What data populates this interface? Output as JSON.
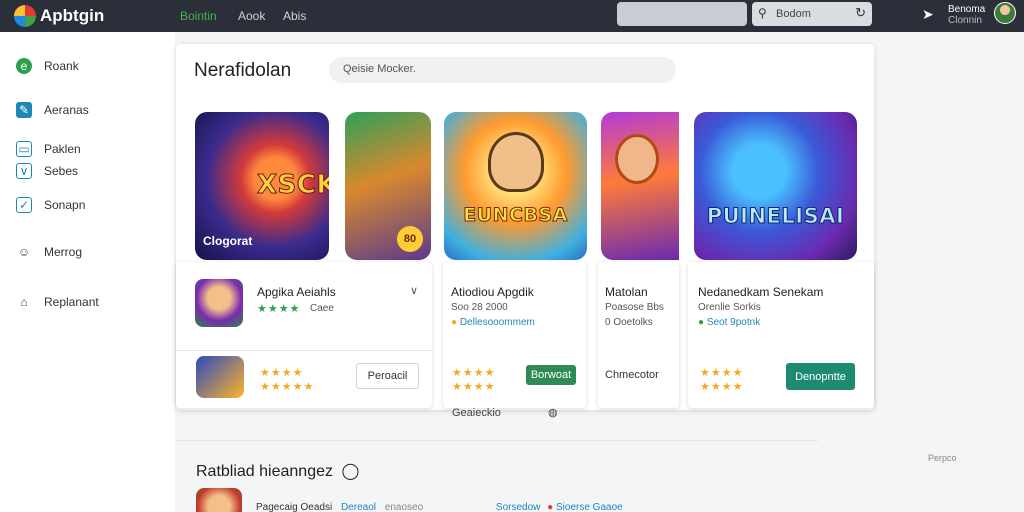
{
  "topbar": {
    "brand": "Apbtgin",
    "nav": [
      {
        "label": "Bointin",
        "active": true
      },
      {
        "label": "Aook",
        "active": false
      },
      {
        "label": "Abis",
        "active": false
      }
    ],
    "search_text": "Bodom",
    "user_line1": "Benoma",
    "user_line2": "Clonnin"
  },
  "sidebar": {
    "items": [
      {
        "label": "Roank",
        "icon": "circle-icon"
      },
      {
        "label": "Aeranas",
        "icon": "square-icon"
      },
      {
        "label": "Paklen",
        "icon": "tray-icon"
      },
      {
        "label": "Sebes",
        "icon": "chevron-down-icon"
      },
      {
        "label": "Sonapn",
        "icon": "check-square-icon"
      },
      {
        "label": "Merrog",
        "icon": "smile-icon"
      },
      {
        "label": "Replanant",
        "icon": "home-icon"
      }
    ]
  },
  "main": {
    "title": "Nerafidolan",
    "search_placeholder": "Qeisie Mocker."
  },
  "tiles": [
    {
      "title": "XSCKN",
      "tag": "Clogorat",
      "badge": "80"
    },
    {
      "title": "EUNCBSA",
      "tag": ""
    },
    {
      "title": "",
      "tag": ""
    },
    {
      "title": "PUINELISAI",
      "tag": ""
    }
  ],
  "cards": [
    {
      "name": "Apgika Aeiahls",
      "sub": "Caee",
      "button": "Peroacil"
    },
    {
      "name": "Atiodiou Apgdik",
      "sub1": "Soo 28 2000",
      "sub2": "Dellesooommem",
      "button": "Borwoat"
    },
    {
      "name": "Matolan",
      "sub1": "Poasose Bbs",
      "sub2": "0 Ooetolks",
      "button": "Chmecotor"
    },
    {
      "name": "Nedanedkam Senekam",
      "sub1": "Orenlie Sorkis",
      "sub2": "Seot 9potnk",
      "button": "Denopntte"
    }
  ],
  "below_cards_text": "Geaieckio",
  "right_small": "Perpco",
  "section_title": "Ratbliad hieanngez",
  "footer_text": "Pagecaig Oeadsi",
  "footer_links": [
    "Dereaol",
    "enaoseo"
  ],
  "footer_tail": "Sorsedow",
  "footer_tail2": "Sioerse Gaaoe",
  "colors": {
    "topbar": "#2a2f3a",
    "accent_green": "#2e8b57",
    "star": "#f5a623"
  }
}
